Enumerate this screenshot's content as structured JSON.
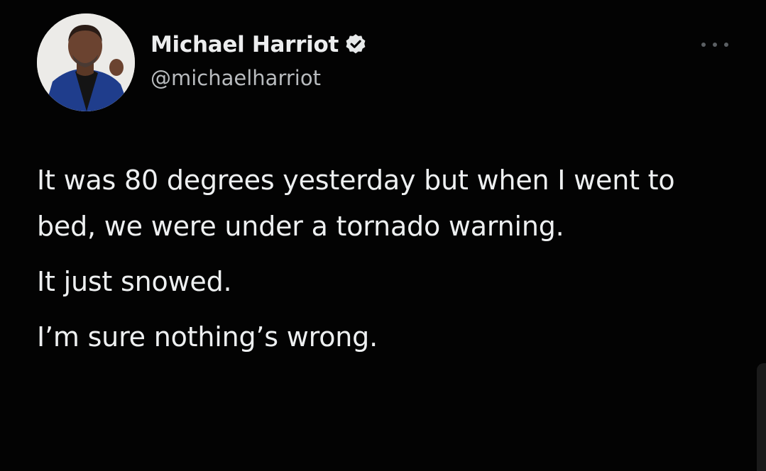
{
  "tweet": {
    "author": {
      "display_name": "Michael Harriot",
      "handle": "@michaelharriot",
      "verified": true,
      "avatar_icon": "profile-photo"
    },
    "more_icon": "more-options-icon",
    "paragraphs": [
      "It was 80 degrees yesterday but when I went to bed, we were under a tornado warning.",
      "It just snowed.",
      "I’m sure nothing’s wrong."
    ]
  },
  "colors": {
    "background": "#030303",
    "text_primary": "#eef0f1",
    "text_secondary": "#b8bbbe",
    "verified_badge": "#e7e9ea"
  }
}
